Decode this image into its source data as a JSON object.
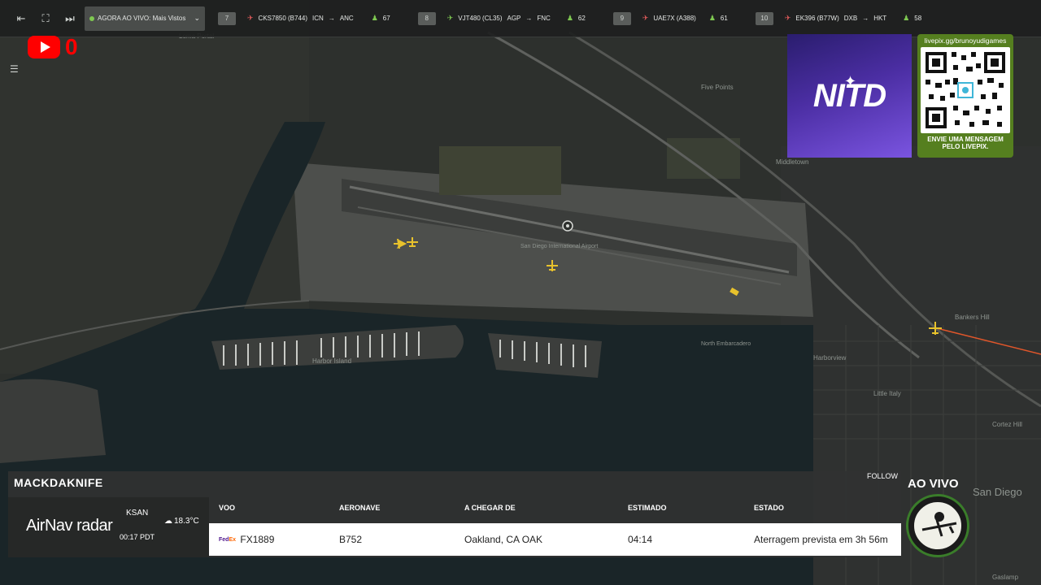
{
  "topbar": {
    "live_label": "AGORA AO VIVO: Mais Vistos",
    "flights": [
      {
        "rank": "7",
        "callsign": "CKS7850 (B744)",
        "route_from": "ICN",
        "route_to": "ANC",
        "count": "67",
        "plane_color": "#e35b5b"
      },
      {
        "rank": "8",
        "callsign": "VJT480 (CL35)",
        "route_from": "AGP",
        "route_to": "FNC",
        "count": "62",
        "plane_color": "#7ec851"
      },
      {
        "rank": "9",
        "callsign": "UAE7X (A388)",
        "route_from": "",
        "route_to": "",
        "count": "61",
        "plane_color": "#e35b5b"
      },
      {
        "rank": "10",
        "callsign": "EK396 (B77W)",
        "route_from": "DXB",
        "route_to": "HKT",
        "count": "58",
        "plane_color": "#e35b5b"
      }
    ]
  },
  "youtube": {
    "count": "0"
  },
  "nitd": {
    "logo_text": "NITD"
  },
  "qr": {
    "url": "livepix.gg/brunoyudigames",
    "message_line1": "ENVIE UMA MENSAGEM",
    "message_line2": "PELO LIVEPIX."
  },
  "map_labels": {
    "loma_portal": "Loma Portal",
    "five_points": "Five Points",
    "middletown": "Middletown",
    "san_diego_airport": "San Diego International Airport",
    "harbor_island": "Harbor Island",
    "harborview": "Harborview",
    "little_italy": "Little Italy",
    "bankers_hill": "Bankers Hill",
    "cortez_hill": "Cortez Hill",
    "north_embarcadero": "North Embarcadero",
    "san_diego": "San Diego",
    "gaslamp": "Gaslamp"
  },
  "panel": {
    "title": "MACKDAKNIFE",
    "follow": "FOLLOW",
    "brand_bold": "AirNav",
    "brand_light": "radar",
    "airport": "KSAN",
    "time": "00:17 PDT",
    "temperature": "18.3°C",
    "headers": {
      "flight": "VOO",
      "aircraft": "AERONAVE",
      "arriving_from": "A CHEGAR DE",
      "estimated": "ESTIMADO",
      "status": "ESTADO"
    },
    "row": {
      "flight": "FX1889",
      "aircraft": "B752",
      "arriving_from": "Oakland, CA OAK",
      "estimated": "04:14",
      "status": "Aterragem prevista em 3h 56m"
    }
  },
  "ao_vivo": "AO VIVO",
  "colors": {
    "accent_green": "#7ec851",
    "youtube_red": "#ff0000",
    "plane_yellow": "#e8c22c",
    "route_orange": "#e0562a",
    "qr_card_green": "#557f1f"
  }
}
